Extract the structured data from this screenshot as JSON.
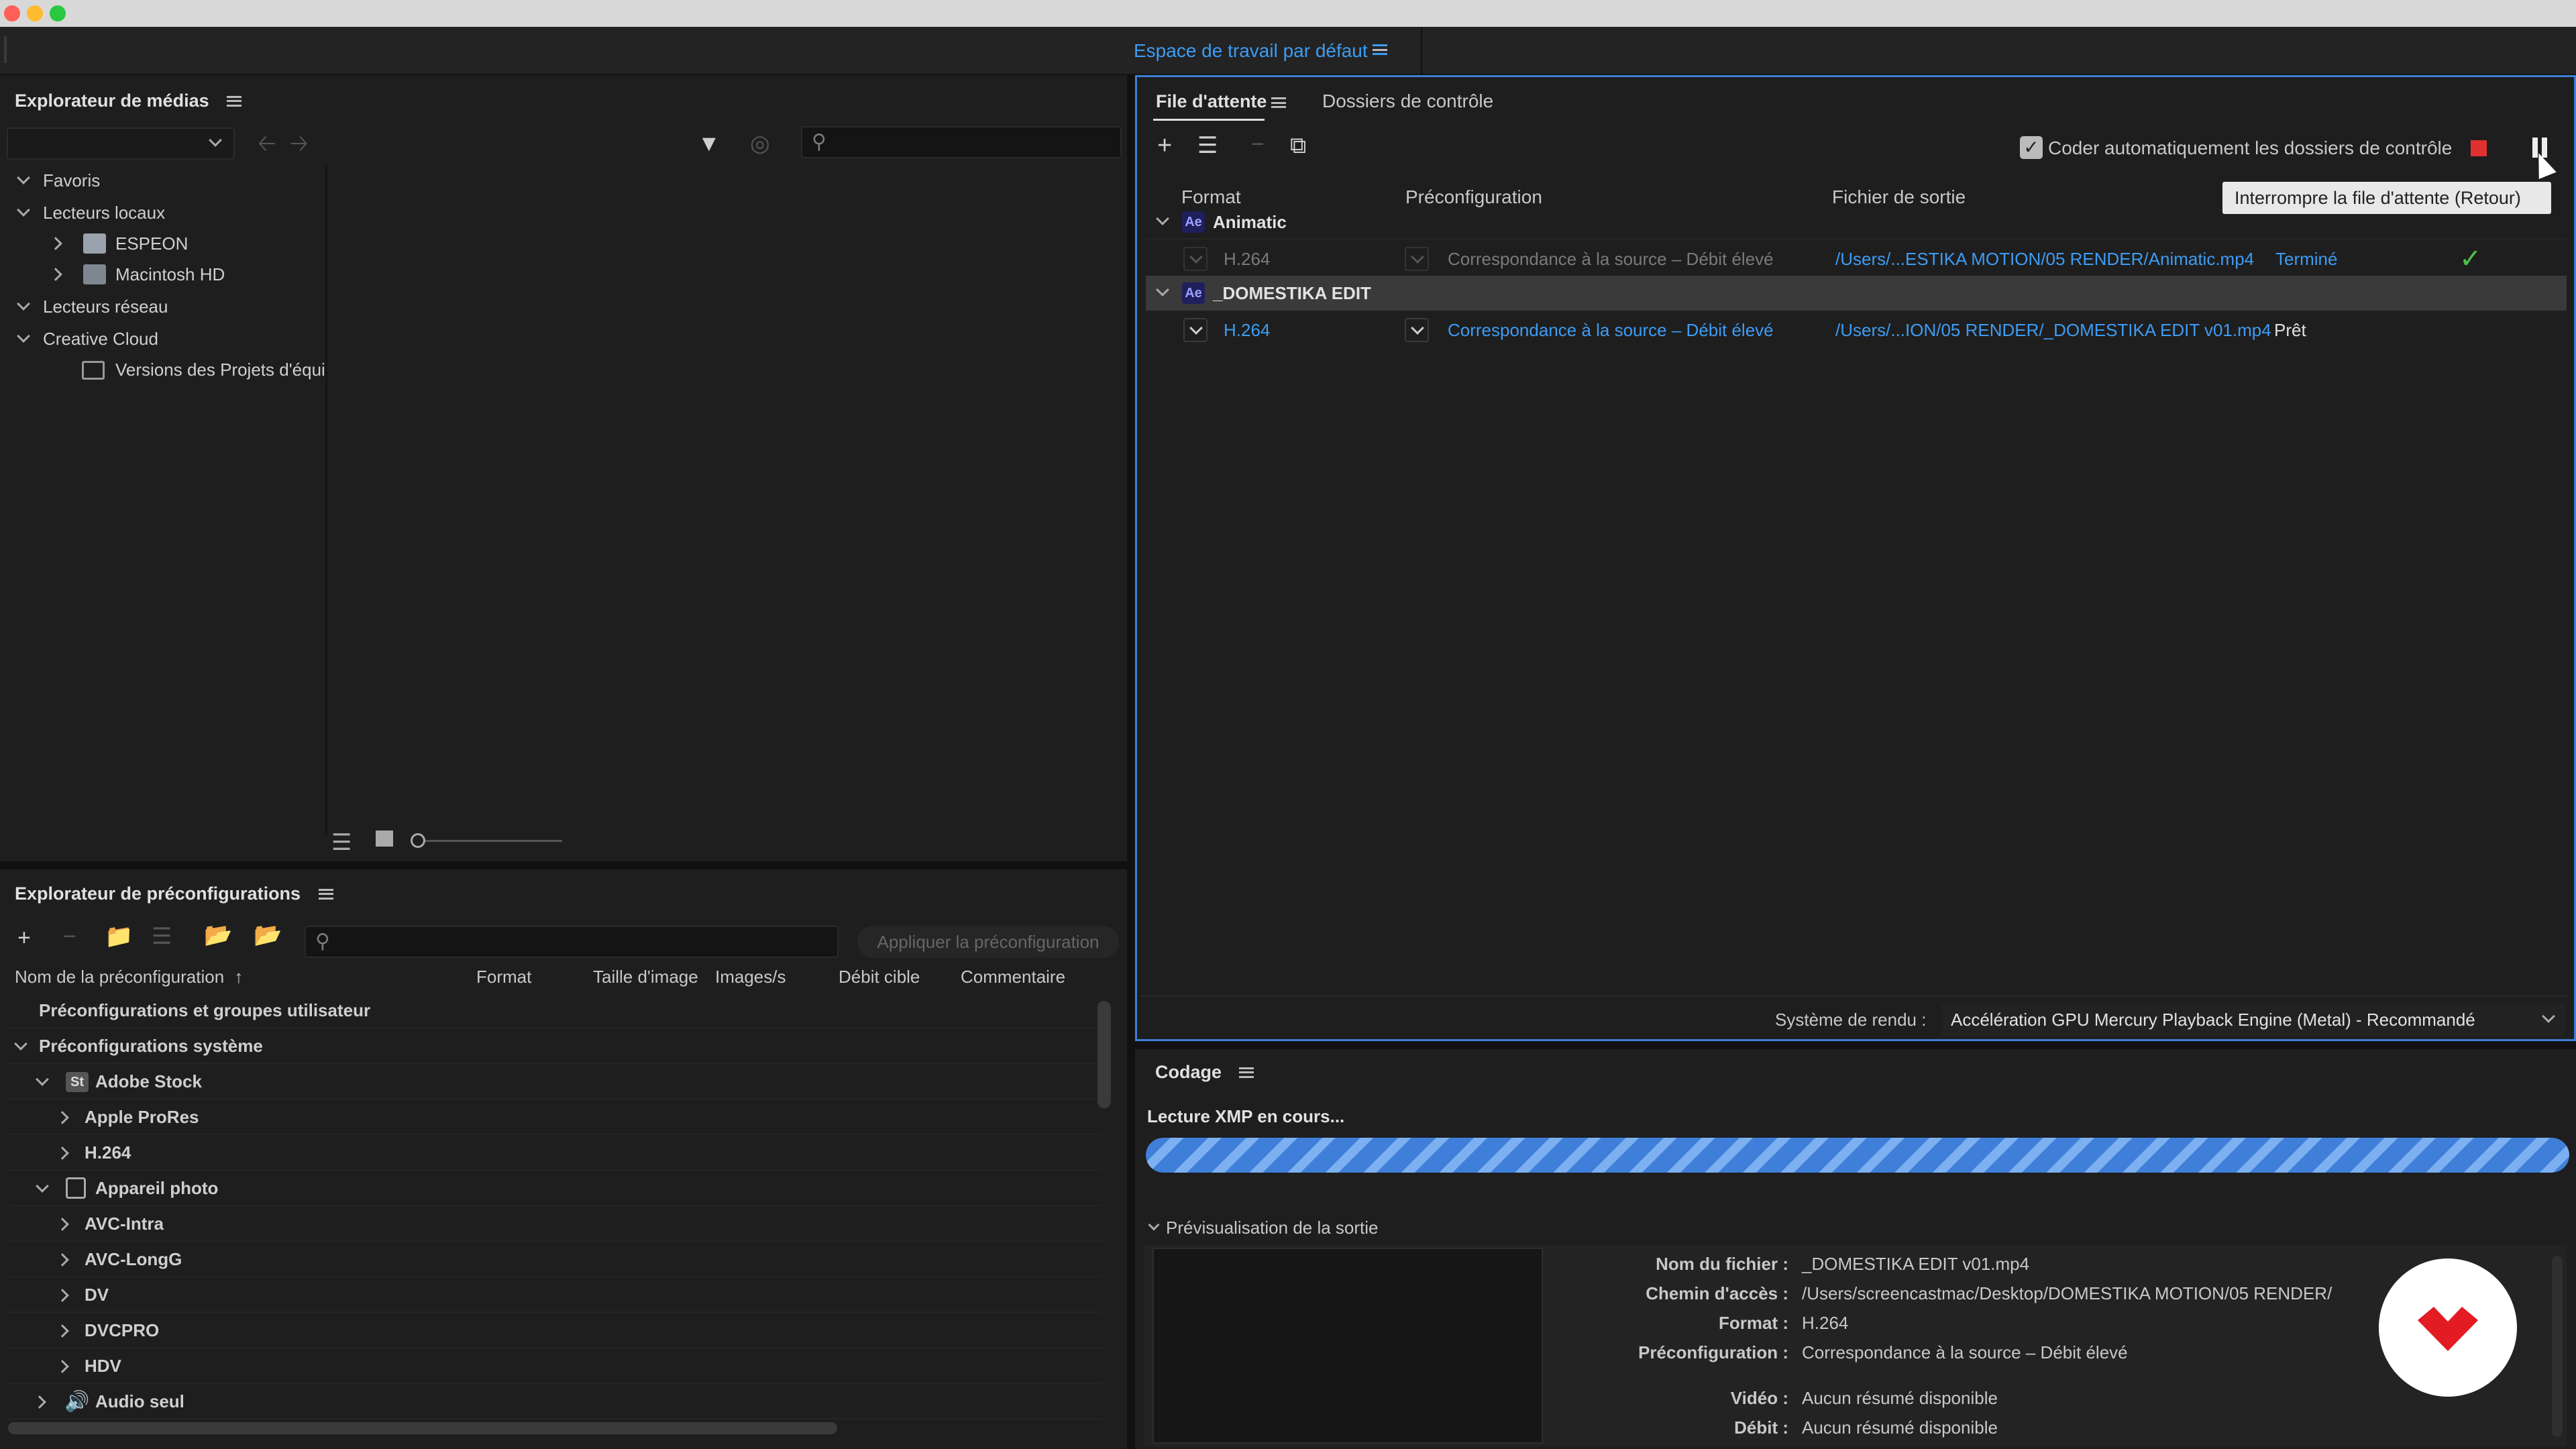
{
  "workspace": {
    "label": "Espace de travail par défaut"
  },
  "media_browser": {
    "title": "Explorateur de médias",
    "tree": [
      {
        "label": "Favoris",
        "level": 0,
        "expanded": true
      },
      {
        "label": "Lecteurs locaux",
        "level": 0,
        "expanded": true
      },
      {
        "label": "ESPEON",
        "level": 1,
        "expanded": false,
        "icon": "drive-icon"
      },
      {
        "label": "Macintosh HD",
        "level": 1,
        "expanded": false,
        "icon": "drive-icon"
      },
      {
        "label": "Lecteurs réseau",
        "level": 0,
        "expanded": true
      },
      {
        "label": "Creative Cloud",
        "level": 0,
        "expanded": true
      },
      {
        "label": "Versions des Projets d'équi",
        "level": 1,
        "icon": "cloud-versions-icon"
      }
    ]
  },
  "preset_browser": {
    "title": "Explorateur de préconfigurations",
    "apply_button": "Appliquer la préconfiguration",
    "columns": [
      "Nom de la préconfiguration",
      "Format",
      "Taille d'image",
      "Images/s",
      "Débit cible",
      "Commentaire"
    ],
    "rows": [
      {
        "label": "Préconfigurations et groupes utilisateur",
        "level": 0
      },
      {
        "label": "Préconfigurations système",
        "level": 0,
        "expanded": true
      },
      {
        "label": "Adobe Stock",
        "level": 1,
        "expanded": true,
        "icon": "adobe-stock-icon",
        "badge": "St"
      },
      {
        "label": "Apple ProRes",
        "level": 2
      },
      {
        "label": "H.264",
        "level": 2
      },
      {
        "label": "Appareil photo",
        "level": 1,
        "expanded": true,
        "icon": "camera-icon"
      },
      {
        "label": "AVC-Intra",
        "level": 2
      },
      {
        "label": "AVC-LongG",
        "level": 2
      },
      {
        "label": "DV",
        "level": 2
      },
      {
        "label": "DVCPRO",
        "level": 2
      },
      {
        "label": "HDV",
        "level": 2
      },
      {
        "label": "Audio seul",
        "level": 0,
        "icon": "speaker-icon"
      }
    ]
  },
  "queue": {
    "tabs": [
      "File d'attente",
      "Dossiers de contrôle"
    ],
    "auto_encode_label": "Coder automatiquement les dossiers de contrôle",
    "tooltip": "Interrompre la file d'attente (Retour)",
    "columns": [
      "Format",
      "Préconfiguration",
      "Fichier de sortie"
    ],
    "groups": [
      {
        "name": "Animatic",
        "badge": "Ae",
        "item": {
          "format": "H.264",
          "preset": "Correspondance à la source – Débit élevé",
          "output": "/Users/...ESTIKA MOTION/05 RENDER/Animatic.mp4",
          "status": "Terminé"
        }
      },
      {
        "name": "_DOMESTIKA EDIT",
        "badge": "Ae",
        "item": {
          "format": "H.264",
          "preset": "Correspondance à la source – Débit élevé",
          "output": "/Users/...ION/05 RENDER/_DOMESTIKA EDIT v01.mp4",
          "status": "Prêt"
        }
      }
    ],
    "renderer_label": "Système de rendu :",
    "renderer_value": "Accélération GPU Mercury Playback Engine (Metal) - Recommandé"
  },
  "encoding": {
    "title": "Codage",
    "status": "Lecture XMP en cours...",
    "progress": 1.0,
    "preview_toggle": "Prévisualisation de la sortie",
    "details": [
      {
        "label": "Nom du fichier :",
        "value": "_DOMESTIKA EDIT v01.mp4"
      },
      {
        "label": "Chemin d'accès :",
        "value": "/Users/screencastmac/Desktop/DOMESTIKA MOTION/05 RENDER/"
      },
      {
        "label": "Format :",
        "value": "H.264"
      },
      {
        "label": "Préconfiguration :",
        "value": "Correspondance à la source – Débit élevé"
      },
      {
        "label": "Vidéo :",
        "value": "Aucun résumé disponible"
      },
      {
        "label": "Débit :",
        "value": "Aucun résumé disponible"
      }
    ]
  },
  "colors": {
    "accent": "#3d9cf5",
    "stop": "#e03030",
    "success": "#4cc24c",
    "logo": "#e31b23"
  }
}
